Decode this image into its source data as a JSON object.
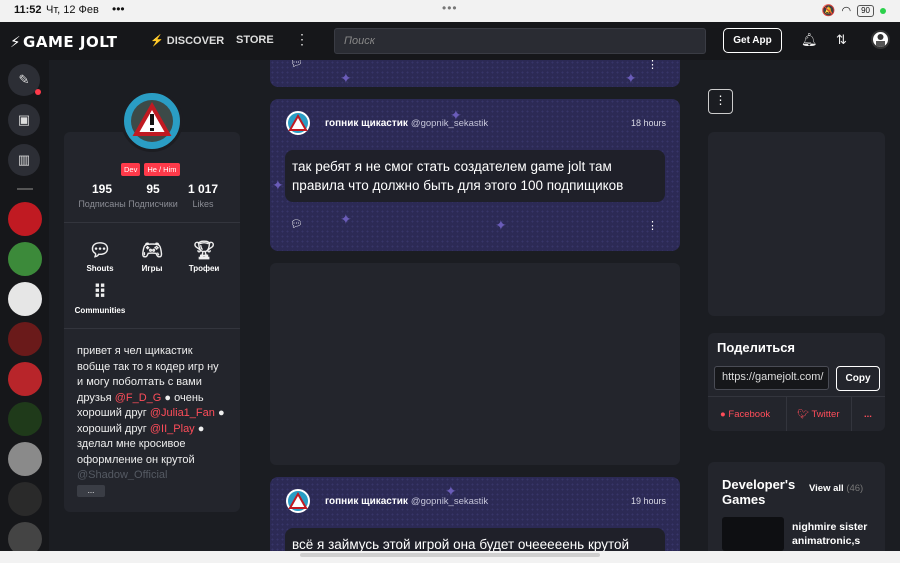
{
  "status_bar": {
    "time": "11:52",
    "date": "Чт, 12 Фев",
    "battery": "90"
  },
  "topnav": {
    "logo": "GAME JOLT",
    "discover": "DISCOVER",
    "store": "STORE",
    "search_placeholder": "Поиск",
    "get_app": "Get App"
  },
  "profile": {
    "badges": [
      "Dev",
      "He / Him"
    ],
    "stats": [
      {
        "value": "195",
        "label": "Подписаны"
      },
      {
        "value": "95",
        "label": "Подписчики"
      },
      {
        "value": "1 017",
        "label": "Likes"
      }
    ],
    "tiles": [
      "Shouts",
      "Игры",
      "Трофеи",
      "Communities"
    ],
    "bio_line1": "привет я чел щикастик вобще так то я кодер игр ну и могу поболтать с вами друзья ",
    "mention1": "@F_D_G",
    "bio_line2": " очень хороший друг ",
    "mention2": "@Julia1_Fan",
    "bio_line3": " хороший друг ",
    "mention3": "@II_Play",
    "bio_line4": " зделал мне кросивое оформление он крутой ",
    "mention4": "@Shadow_Official",
    "more": "..."
  },
  "posts": [
    {
      "user": "гопник щикастик",
      "handle": "@gopnik_sekastik",
      "time": "18 hours",
      "text": "так ребят я не смог стать создателем game jolt там правила что должно быть для этого 100 подпищиков"
    },
    {
      "user": "гопник щикастик",
      "handle": "@gopnik_sekastik",
      "time": "19 hours",
      "text": "всё я займусь этой игрой она будет очееееень крутой"
    }
  ],
  "share": {
    "title": "Поделиться",
    "url": "https://gamejolt.com/",
    "copy": "Copy",
    "facebook": "Facebook",
    "twitter": "Twitter",
    "more": "..."
  },
  "dev_games": {
    "title": "Developer's Games",
    "view_all": "View all",
    "count": "(46)",
    "game_name": "nighmire sister animatronic,s"
  },
  "colors": {
    "accent": "#ff3a4a",
    "background": "#1b1d22",
    "card": "#23252c",
    "post_bg": "#2c2a55"
  }
}
